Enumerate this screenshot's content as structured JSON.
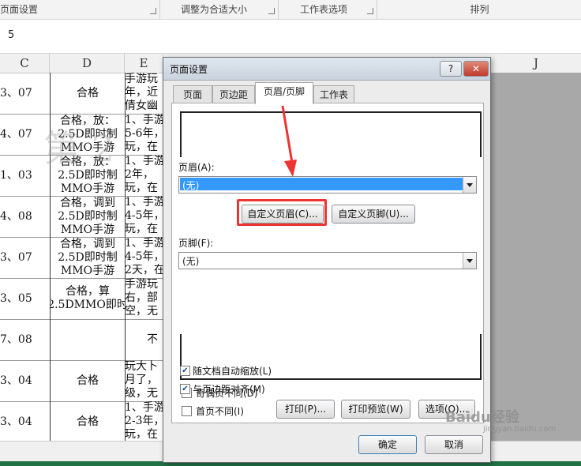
{
  "ribbon": {
    "groups": [
      "页面设置",
      "调整为合适大小",
      "工作表选项",
      "排列"
    ]
  },
  "formula_bar": {
    "value": "5"
  },
  "columns": [
    "C",
    "D",
    "E",
    "J"
  ],
  "sheet": {
    "watermark": "第 2",
    "rows": [
      {
        "c": "3、07",
        "d": "合格",
        "e": "手游玩\n年，近\n倩女幽"
      },
      {
        "c": "4、07",
        "d": "合格，放：\n2.5D即时制\nMMO手游",
        "e": "1、手游\n5-6年，\n玩，在"
      },
      {
        "c": "1、03",
        "d": "合格，放：\n2.5D即时制\nMMO手游",
        "e": "1、手游\n2年，\n玩，在"
      },
      {
        "c": "4、08",
        "d": "合格，调到\n2.5D即时制\nMMO手游",
        "e": "1、手游\n4-5年，\n玩，在"
      },
      {
        "c": "3、07",
        "d": "合格，调到\n2.5D即时制\nMMO手游",
        "e": "1、手游\n4-5年，\n2天，在"
      },
      {
        "c": "3、05",
        "d": "合格，算\n2.5DMMO即时",
        "e": "手游玩\n右，部\n空，无"
      },
      {
        "c": "7、08",
        "d": "",
        "e": "不"
      },
      {
        "c": "3、04",
        "d": "合格",
        "e": "玩大卜\n月了，\n级，无"
      },
      {
        "c": "3、04",
        "d": "合格",
        "e": "1、手游\n2-3年，\n玩，在"
      }
    ]
  },
  "dialog": {
    "title": "页面设置",
    "help_label": "?",
    "close_label": "✕",
    "tabs": [
      "页面",
      "页边距",
      "页眉/页脚",
      "工作表"
    ],
    "header_label": "页眉(A):",
    "header_value": "(无)",
    "custom_header_label": "自定义页眉(C)...",
    "custom_footer_label": "自定义页脚(U)...",
    "footer_label": "页脚(F):",
    "footer_value": "(无)",
    "checkboxes": [
      {
        "label": "奇偶页不同(D)",
        "checked": false
      },
      {
        "label": "首页不同(I)",
        "checked": false
      },
      {
        "label": "随文档自动缩放(L)",
        "checked": true
      },
      {
        "label": "与页边距对齐(M)",
        "checked": true
      }
    ],
    "print_label": "打印(P)...",
    "print_preview_label": "打印预览(W)",
    "options_label": "选项(O)...",
    "ok_label": "确定",
    "cancel_label": "取消"
  },
  "watermark_brand": {
    "name": "Baidu经验",
    "sub": "jingyan.baidu.com"
  },
  "colors": {
    "highlight": "#ee3333",
    "selection": "#3399ff",
    "status_bar": "#217346"
  }
}
